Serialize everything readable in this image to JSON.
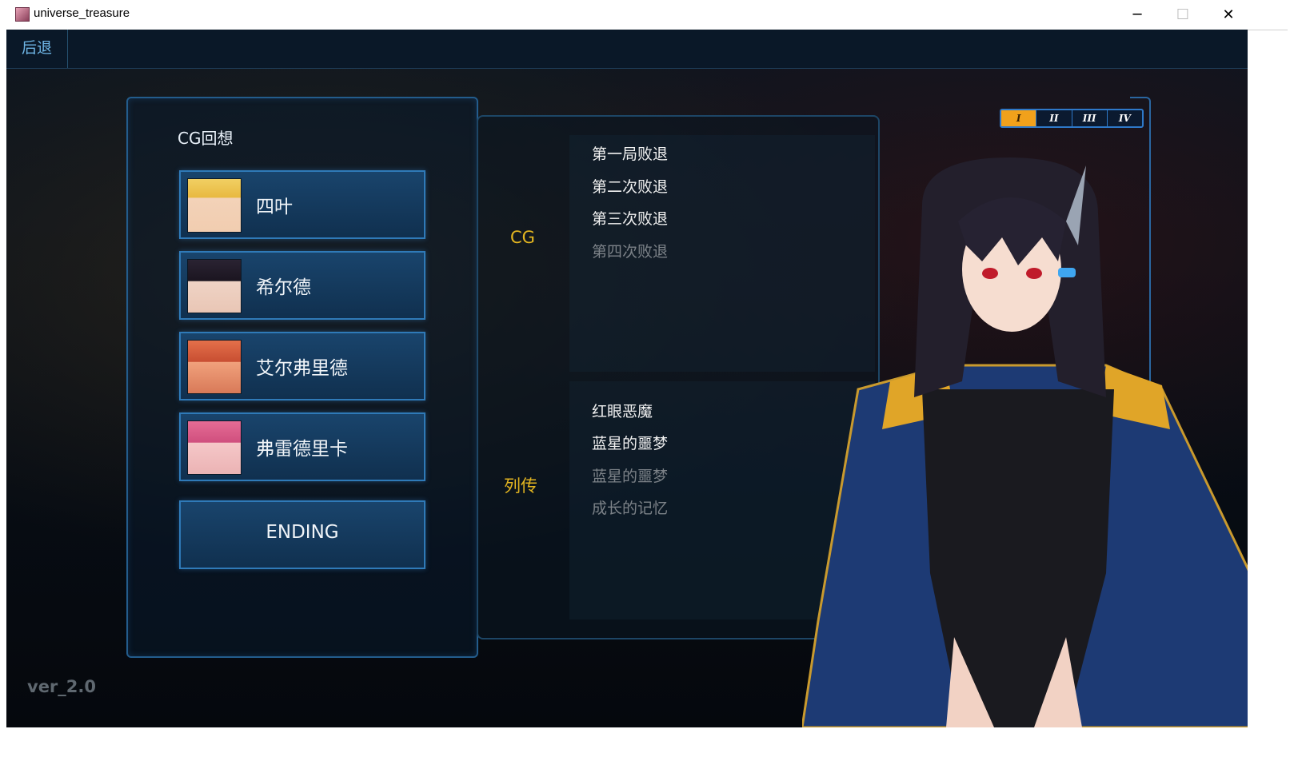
{
  "window": {
    "title": "universe_treasure",
    "minimize_label": "─",
    "maximize_label": "☐",
    "close_label": "✕"
  },
  "topbar": {
    "back_label": "后退"
  },
  "left_panel": {
    "title": "CG回想",
    "characters": [
      {
        "name": "四叶"
      },
      {
        "name": "希尔德"
      },
      {
        "name": "艾尔弗里德"
      },
      {
        "name": "弗雷德里卡"
      }
    ],
    "ending_label": "ENDING"
  },
  "middle_panel": {
    "cg_label": "CG",
    "cg_items": [
      {
        "label": "第一局败退",
        "enabled": true
      },
      {
        "label": "第二次败退",
        "enabled": true
      },
      {
        "label": "第三次败退",
        "enabled": true
      },
      {
        "label": "第四次败退",
        "enabled": false
      }
    ],
    "biography_label": "列传",
    "biography_items": [
      {
        "label": "红眼恶魔",
        "enabled": true
      },
      {
        "label": "蓝星的噩梦",
        "enabled": true
      },
      {
        "label": "蓝星的噩梦",
        "enabled": false
      },
      {
        "label": "成长的记忆",
        "enabled": false
      }
    ]
  },
  "tabs": [
    {
      "label": "I",
      "active": true
    },
    {
      "label": "II",
      "active": false
    },
    {
      "label": "III",
      "active": false
    },
    {
      "label": "IV",
      "active": false
    }
  ],
  "version": "ver_2.0",
  "colors": {
    "accent_gold": "#e3b520",
    "frame_blue": "#2f7ab8",
    "tab_active": "#f1a11b"
  }
}
